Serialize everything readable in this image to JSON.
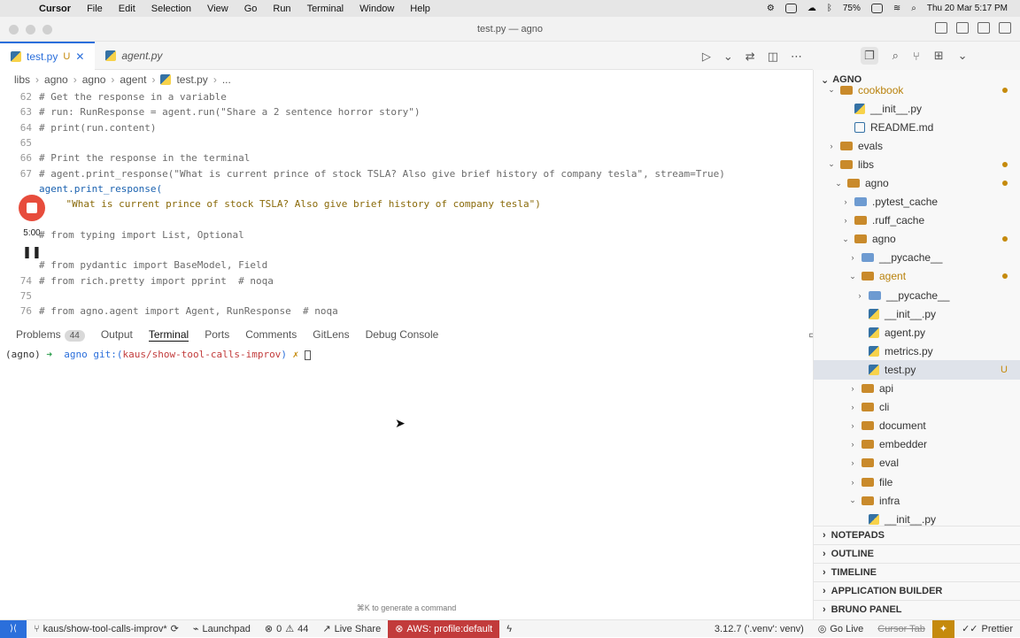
{
  "mac_menu": {
    "app": "Cursor",
    "items": [
      "File",
      "Edit",
      "Selection",
      "View",
      "Go",
      "Run",
      "Terminal",
      "Window",
      "Help"
    ],
    "battery": "75%",
    "clock": "Thu 20 Mar 5:17 PM"
  },
  "window": {
    "title": "test.py — agno"
  },
  "tabs": [
    {
      "label": "test.py",
      "modified": "U"
    },
    {
      "label": "agent.py"
    }
  ],
  "breadcrumb": [
    "libs",
    "agno",
    "agno",
    "agent",
    "test.py",
    "..."
  ],
  "editor": {
    "lines": [
      {
        "n": "62",
        "text": "# Get the response in a variable",
        "kind": "comment"
      },
      {
        "n": "63",
        "text": "# run: RunResponse = agent.run(\"Share a 2 sentence horror story\")",
        "kind": "comment"
      },
      {
        "n": "64",
        "text": "# print(run.content)",
        "kind": "comment"
      },
      {
        "n": "65",
        "text": "",
        "kind": "code"
      },
      {
        "n": "66",
        "text": "# Print the response in the terminal",
        "kind": "comment"
      },
      {
        "n": "67",
        "text": "# agent.print_response(\"What is current prince of stock TSLA? Also give brief history of company tesla\", stream=True)",
        "kind": "comment"
      },
      {
        "n": "",
        "text": "agent.print_response(",
        "kind": "fn"
      },
      {
        "n": "",
        "text": "    \"What is current prince of stock TSLA? Also give brief history of company tesla\")",
        "kind": "string"
      },
      {
        "n": "",
        "text": "",
        "kind": "code"
      },
      {
        "n": "",
        "text": "# from typing import List, Optional",
        "kind": "comment"
      },
      {
        "n": "",
        "text": "",
        "kind": "code"
      },
      {
        "n": "",
        "text": "# from pydantic import BaseModel, Field",
        "kind": "comment"
      },
      {
        "n": "74",
        "text": "# from rich.pretty import pprint  # noqa",
        "kind": "comment"
      },
      {
        "n": "75",
        "text": "",
        "kind": "code"
      },
      {
        "n": "76",
        "text": "# from agno.agent import Agent, RunResponse  # noqa",
        "kind": "comment"
      }
    ]
  },
  "recorder": {
    "time": "5:00"
  },
  "panel": {
    "tabs": [
      "Problems",
      "Output",
      "Terminal",
      "Ports",
      "Comments",
      "GitLens",
      "Debug Console"
    ],
    "problems_count": "44",
    "active": "Terminal",
    "shell": "zsh"
  },
  "terminal": {
    "env": "(agno)",
    "arrow": "➜",
    "dir": "agno",
    "git_label": "git:(",
    "branch": "kaus/show-tool-calls-improv",
    "git_close": ")",
    "dirty": "✗"
  },
  "hint": "⌘K to generate a command",
  "explorer": {
    "header": "AGNO",
    "rows": [
      {
        "label": "cookbook",
        "indent": 1,
        "type": "folder",
        "chev": "⌄",
        "gold": true,
        "dot": true
      },
      {
        "label": "__init__.py",
        "indent": 3,
        "type": "py"
      },
      {
        "label": "README.md",
        "indent": 3,
        "type": "md"
      },
      {
        "label": "evals",
        "indent": 1,
        "type": "folder",
        "chev": "›"
      },
      {
        "label": "libs",
        "indent": 1,
        "type": "folder",
        "chev": "⌄",
        "dot": true
      },
      {
        "label": "agno",
        "indent": 2,
        "type": "folder",
        "chev": "⌄",
        "dot": true
      },
      {
        "label": ".pytest_cache",
        "indent": 3,
        "type": "special",
        "chev": "›"
      },
      {
        "label": ".ruff_cache",
        "indent": 3,
        "type": "folder",
        "chev": "›"
      },
      {
        "label": "agno",
        "indent": 3,
        "type": "folder",
        "chev": "⌄",
        "dot": true
      },
      {
        "label": "__pycache__",
        "indent": 4,
        "type": "special",
        "chev": "›"
      },
      {
        "label": "agent",
        "indent": 4,
        "type": "folder",
        "chev": "⌄",
        "gold": true,
        "dot": true
      },
      {
        "label": "__pycache__",
        "indent": 5,
        "type": "special",
        "chev": "›"
      },
      {
        "label": "__init__.py",
        "indent": 5,
        "type": "py"
      },
      {
        "label": "agent.py",
        "indent": 5,
        "type": "py"
      },
      {
        "label": "metrics.py",
        "indent": 5,
        "type": "py"
      },
      {
        "label": "test.py",
        "indent": 5,
        "type": "py",
        "selected": true,
        "badge": "U"
      },
      {
        "label": "api",
        "indent": 4,
        "type": "folder",
        "chev": "›"
      },
      {
        "label": "cli",
        "indent": 4,
        "type": "folder",
        "chev": "›"
      },
      {
        "label": "document",
        "indent": 4,
        "type": "folder",
        "chev": "›"
      },
      {
        "label": "embedder",
        "indent": 4,
        "type": "folder",
        "chev": "›"
      },
      {
        "label": "eval",
        "indent": 4,
        "type": "folder",
        "chev": "›"
      },
      {
        "label": "file",
        "indent": 4,
        "type": "folder",
        "chev": "›"
      },
      {
        "label": "infra",
        "indent": 4,
        "type": "folder",
        "chev": "⌄"
      },
      {
        "label": "__init__.py",
        "indent": 5,
        "type": "py"
      }
    ]
  },
  "sections": [
    "NOTEPADS",
    "OUTLINE",
    "TIMELINE",
    "APPLICATION BUILDER",
    "BRUNO PANEL"
  ],
  "statusbar": {
    "branch": "kaus/show-tool-calls-improv*",
    "launchpad": "Launchpad",
    "errors": "0",
    "warnings": "44",
    "live_share": "Live Share",
    "aws": "AWS: profile:default",
    "python": "3.12.7 ('.venv': venv)",
    "go_live": "Go Live",
    "cursor_tab": "Cursor Tab",
    "prettier": "Prettier"
  }
}
